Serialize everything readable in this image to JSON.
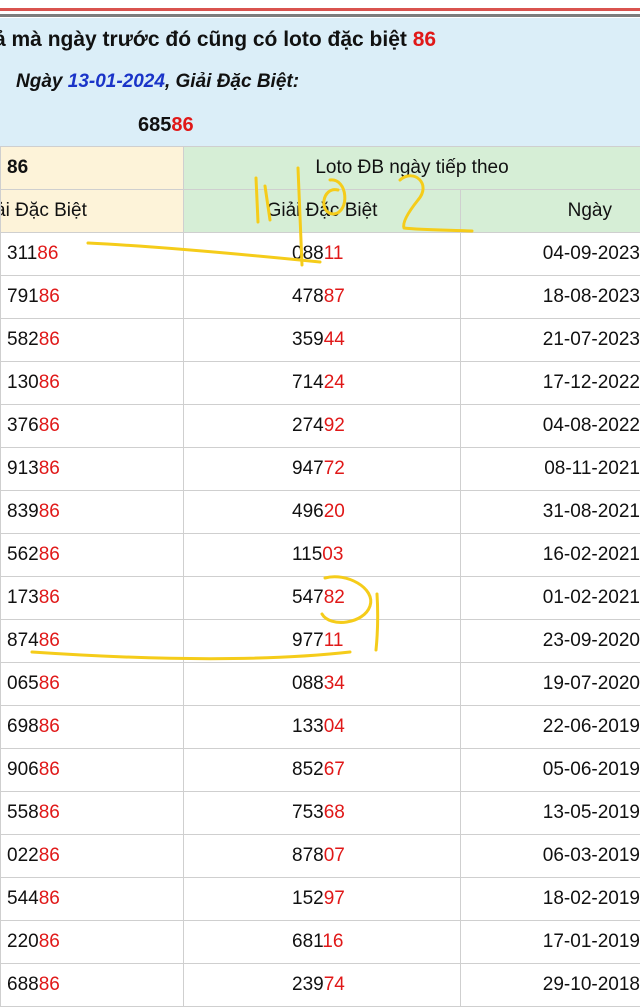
{
  "header": {
    "headline_text": "ả mà ngày trước đó cũng có loto đặc biệt ",
    "headline_number": "86",
    "date_prefix": "Ngày ",
    "date_value": "13-01-2024",
    "date_suffix": ", Giải Đặc Biệt:",
    "special_prefix": "685",
    "special_tail": "86"
  },
  "table": {
    "top_left_number": "86",
    "top_right_label": "Loto ĐB ngày tiếp theo",
    "col_left_label": "ải Đặc Biệt",
    "col_mid_label": "Giải Đặc Biệt",
    "col_right_label": "Ngày",
    "rows": [
      {
        "left_head": "311",
        "left_tail": "86",
        "mid_head": "088",
        "mid_tail": "11",
        "date": "04-09-2023"
      },
      {
        "left_head": "791",
        "left_tail": "86",
        "mid_head": "478",
        "mid_tail": "87",
        "date": "18-08-2023"
      },
      {
        "left_head": "582",
        "left_tail": "86",
        "mid_head": "359",
        "mid_tail": "44",
        "date": "21-07-2023"
      },
      {
        "left_head": "130",
        "left_tail": "86",
        "mid_head": "714",
        "mid_tail": "24",
        "date": "17-12-2022"
      },
      {
        "left_head": "376",
        "left_tail": "86",
        "mid_head": "274",
        "mid_tail": "92",
        "date": "04-08-2022"
      },
      {
        "left_head": "913",
        "left_tail": "86",
        "mid_head": "947",
        "mid_tail": "72",
        "date": "08-11-2021"
      },
      {
        "left_head": "839",
        "left_tail": "86",
        "mid_head": "496",
        "mid_tail": "20",
        "date": "31-08-2021"
      },
      {
        "left_head": "562",
        "left_tail": "86",
        "mid_head": "115",
        "mid_tail": "03",
        "date": "16-02-2021"
      },
      {
        "left_head": "173",
        "left_tail": "86",
        "mid_head": "547",
        "mid_tail": "82",
        "date": "01-02-2021"
      },
      {
        "left_head": "874",
        "left_tail": "86",
        "mid_head": "977",
        "mid_tail": "11",
        "date": "23-09-2020"
      },
      {
        "left_head": "065",
        "left_tail": "86",
        "mid_head": "088",
        "mid_tail": "34",
        "date": "19-07-2020"
      },
      {
        "left_head": "698",
        "left_tail": "86",
        "mid_head": "133",
        "mid_tail": "04",
        "date": "22-06-2019"
      },
      {
        "left_head": "906",
        "left_tail": "86",
        "mid_head": "852",
        "mid_tail": "67",
        "date": "05-06-2019"
      },
      {
        "left_head": "558",
        "left_tail": "86",
        "mid_head": "753",
        "mid_tail": "68",
        "date": "13-05-2019"
      },
      {
        "left_head": "022",
        "left_tail": "86",
        "mid_head": "878",
        "mid_tail": "07",
        "date": "06-03-2019"
      },
      {
        "left_head": "544",
        "left_tail": "86",
        "mid_head": "152",
        "mid_tail": "97",
        "date": "18-02-2019"
      },
      {
        "left_head": "220",
        "left_tail": "86",
        "mid_head": "681",
        "mid_tail": "16",
        "date": "17-01-2019"
      },
      {
        "left_head": "688",
        "left_tail": "86",
        "mid_head": "239",
        "mid_tail": "74",
        "date": "29-10-2018"
      }
    ]
  },
  "colors": {
    "highlight_red": "#e01818",
    "date_blue": "#1a34c8",
    "header_bg": "#dbeef8",
    "green_header": "#d6eed6",
    "cream_header": "#fdf3d9",
    "annotation_yellow": "#f5cc1a"
  }
}
